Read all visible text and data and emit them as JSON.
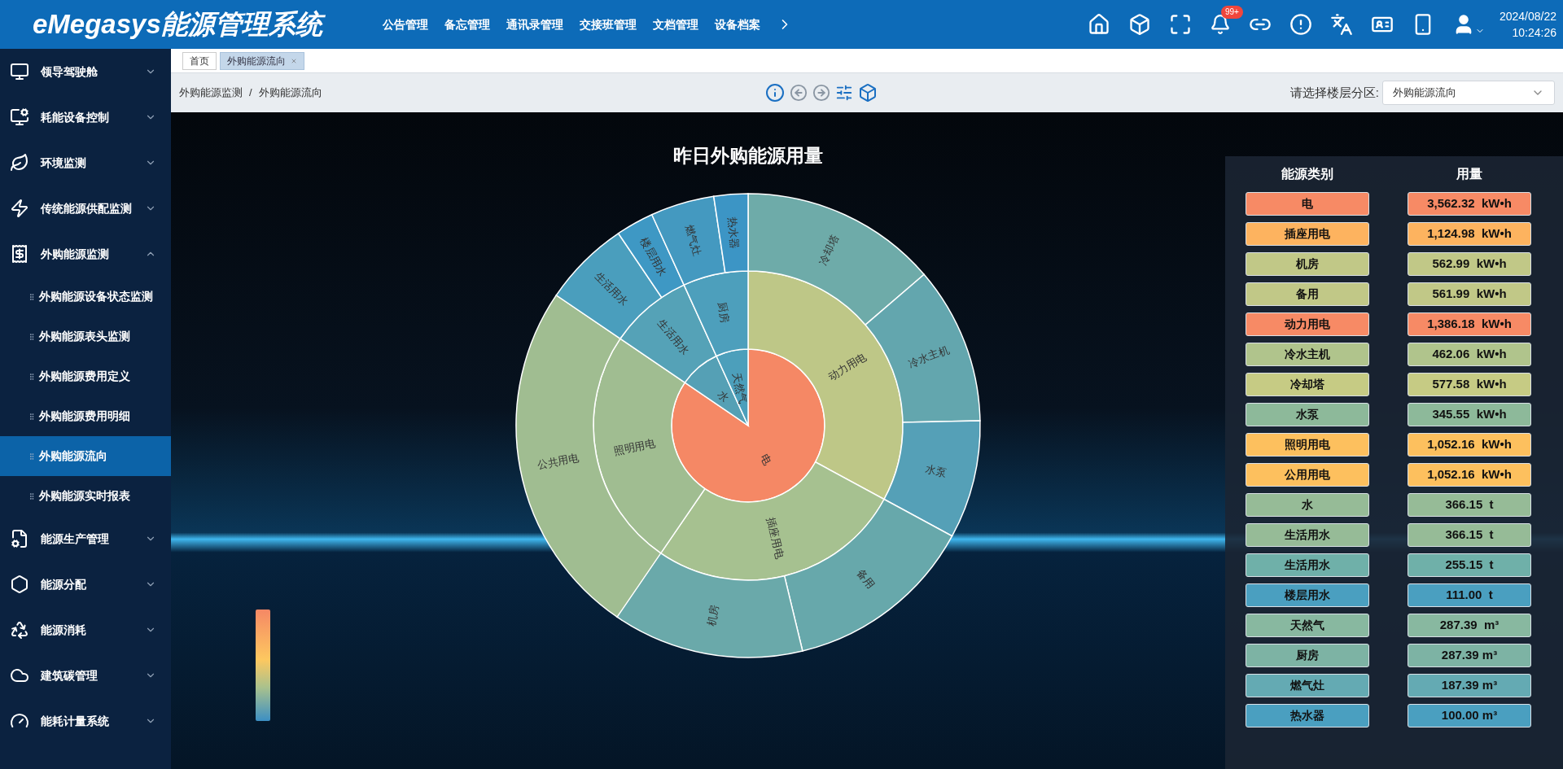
{
  "header": {
    "logo": "eMegasys能源管理系统",
    "nav": [
      "公告管理",
      "备忘管理",
      "通讯录管理",
      "交接班管理",
      "文档管理",
      "设备档案"
    ],
    "badge": "99+",
    "date": "2024/08/22",
    "time": "10:24:26"
  },
  "sidebar": {
    "items": [
      {
        "label": "领导驾驶舱",
        "expanded": false
      },
      {
        "label": "耗能设备控制",
        "expanded": false
      },
      {
        "label": "环境监测",
        "expanded": false
      },
      {
        "label": "传统能源供配监测",
        "expanded": false
      },
      {
        "label": "外购能源监测",
        "expanded": true,
        "children": [
          {
            "label": "外购能源设备状态监测",
            "selected": false
          },
          {
            "label": "外购能源表头监测",
            "selected": false
          },
          {
            "label": "外购能源费用定义",
            "selected": false
          },
          {
            "label": "外购能源费用明细",
            "selected": false
          },
          {
            "label": "外购能源流向",
            "selected": true
          },
          {
            "label": "外购能源实时报表",
            "selected": false
          }
        ]
      },
      {
        "label": "能源生产管理",
        "expanded": false
      },
      {
        "label": "能源分配",
        "expanded": false
      },
      {
        "label": "能源消耗",
        "expanded": false
      },
      {
        "label": "建筑碳管理",
        "expanded": false
      },
      {
        "label": "能耗计量系统",
        "expanded": false
      }
    ]
  },
  "tabs": [
    {
      "label": "首页",
      "selected": false
    },
    {
      "label": "外购能源流向",
      "selected": true
    }
  ],
  "breadcrumb": {
    "separator": "/",
    "items": [
      "外购能源监测",
      "外购能源流向"
    ]
  },
  "floor_select": {
    "label": "请选择楼层分区:",
    "value": "外购能源流向"
  },
  "chart": {
    "title": "昨日外购能源用量",
    "nodes": [
      {
        "label": "电",
        "color": "#f58865",
        "children": [
          {
            "label": "动力用电",
            "color": "#bec787",
            "children": [
              {
                "label": "冷却塔",
                "color": "#6eaba9"
              },
              {
                "label": "冷水主机",
                "color": "#63a6ae"
              },
              {
                "label": "水泵",
                "color": "#55a0b7"
              }
            ]
          },
          {
            "label": "插座用电",
            "color": "#a6c190",
            "children": [
              {
                "label": "备用",
                "color": "#67a8ab"
              },
              {
                "label": "机房",
                "color": "#6aa9aa"
              }
            ]
          },
          {
            "label": "照明用电",
            "color": "#a0bd91",
            "children": [
              {
                "label": "公共用电",
                "color": "#a0bd91"
              }
            ]
          }
        ]
      },
      {
        "label": "水",
        "color": "#55a0b5",
        "children": [
          {
            "label": "生活用水",
            "color": "#55a2b7",
            "children": [
              {
                "label": "生活用水",
                "color": "#4a9ebd"
              },
              {
                "label": "楼层用水",
                "color": "#3e98c4"
              }
            ]
          }
        ]
      },
      {
        "label": "天然气",
        "color": "#4c9fbb",
        "children": [
          {
            "label": "厨房",
            "color": "#4d9fbc",
            "children": [
              {
                "label": "燃气灶",
                "color": "#4499c0"
              },
              {
                "label": "热水器",
                "color": "#3c95c5"
              }
            ]
          }
        ]
      }
    ]
  },
  "table": {
    "columns": [
      "能源类别",
      "用量"
    ],
    "rows": [
      {
        "label": "电",
        "amount": "3,562.32  kW•h",
        "color": "#f78a65"
      },
      {
        "label": "插座用电",
        "amount": "1,124.98  kW•h",
        "color": "#fdb35f"
      },
      {
        "label": "机房",
        "amount": "562.99  kW•h",
        "color": "#c1c887"
      },
      {
        "label": "备用",
        "amount": "561.99  kW•h",
        "color": "#c1c887"
      },
      {
        "label": "动力用电",
        "amount": "1,386.18  kW•h",
        "color": "#f78a65"
      },
      {
        "label": "冷水主机",
        "amount": "462.06  kW•h",
        "color": "#b0c48c"
      },
      {
        "label": "冷却塔",
        "amount": "577.58  kW•h",
        "color": "#c6cb84"
      },
      {
        "label": "水泵",
        "amount": "345.55  kW•h",
        "color": "#8db99a"
      },
      {
        "label": "照明用电",
        "amount": "1,052.16  kW•h",
        "color": "#fdc05e"
      },
      {
        "label": "公用用电",
        "amount": "1,052.16  kW•h",
        "color": "#fdc05e"
      },
      {
        "label": "水",
        "amount": "366.15  t",
        "color": "#96bb97"
      },
      {
        "label": "生活用水",
        "amount": "366.15  t",
        "color": "#96bb97"
      },
      {
        "label": "生活用水",
        "amount": "255.15  t",
        "color": "#6fb0a9"
      },
      {
        "label": "楼层用水",
        "amount": "111.00  t",
        "color": "#4a9fc0"
      },
      {
        "label": "天然气",
        "amount": "287.39  m³",
        "color": "#88b8a0"
      },
      {
        "label": "厨房",
        "amount": "287.39 m³",
        "color": "#7db3a4"
      },
      {
        "label": "燃气灶",
        "amount": "187.39 m³",
        "color": "#64aab3"
      },
      {
        "label": "热水器",
        "amount": "100.00 m³",
        "color": "#4a9fc0"
      }
    ]
  }
}
